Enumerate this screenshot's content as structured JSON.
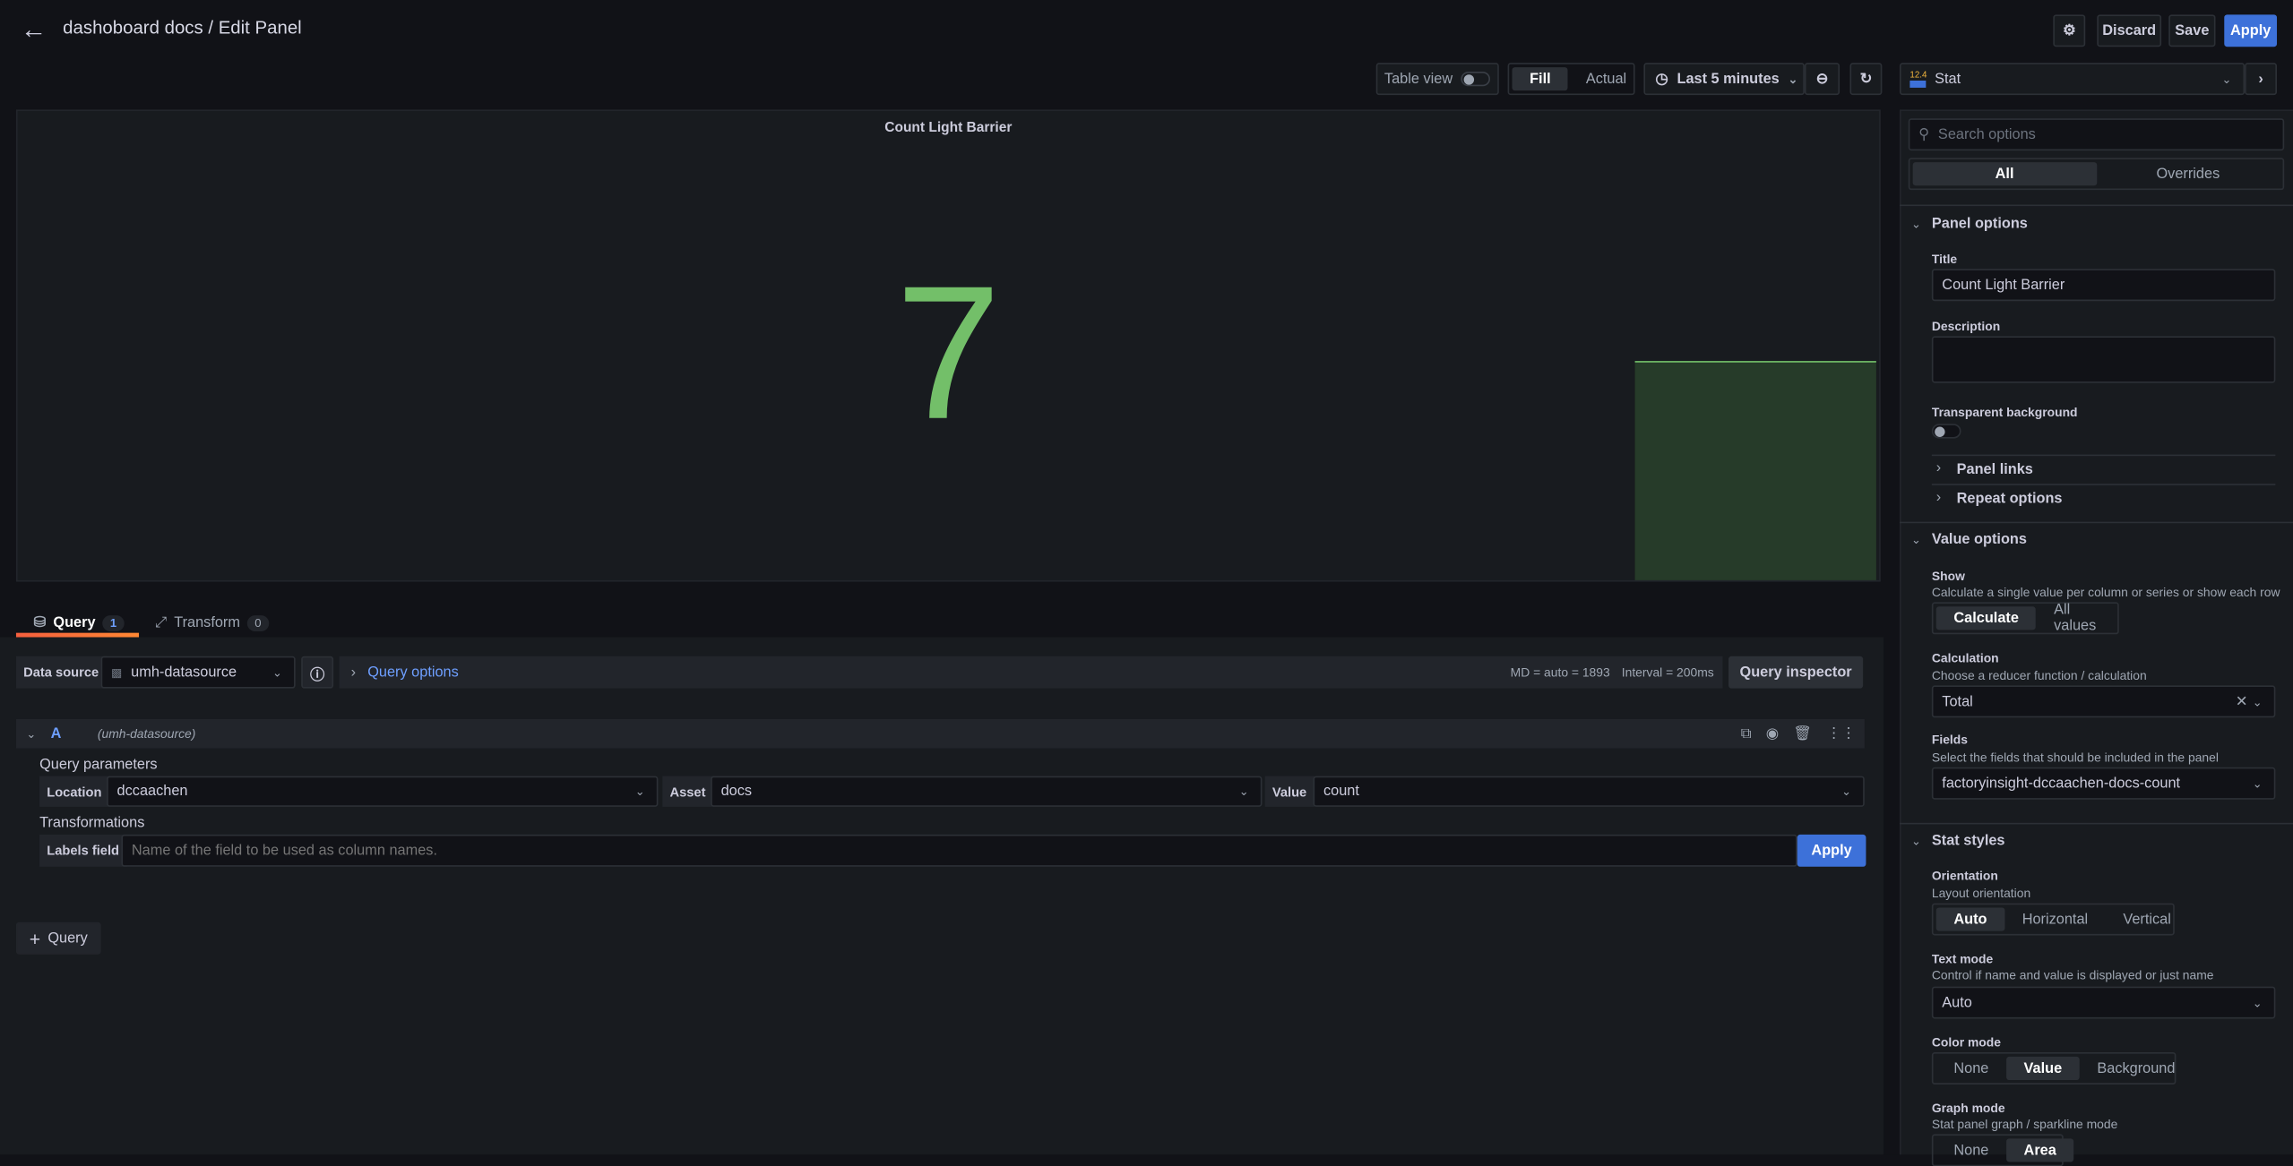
{
  "header": {
    "title": "dashoboard docs / Edit Panel",
    "discard": "Discard",
    "save": "Save",
    "apply": "Apply"
  },
  "toolbar": {
    "table_view": "Table view",
    "fill": "Fill",
    "actual": "Actual",
    "time_range": "Last 5 minutes",
    "visualization": "Stat",
    "viz_icon_text": "12.4"
  },
  "panel": {
    "title": "Count Light Barrier",
    "value": "7",
    "value_color": "#73bf69"
  },
  "tabs": [
    {
      "label": "Query",
      "count": "1"
    },
    {
      "label": "Transform",
      "count": "0"
    }
  ],
  "datasource": {
    "label": "Data source",
    "value": "umh-datasource",
    "query_options": "Query options",
    "md": "MD = auto = 1893",
    "interval": "Interval = 200ms",
    "inspector": "Query inspector"
  },
  "query": {
    "ref": "A",
    "source": "(umh-datasource)",
    "params_label": "Query parameters",
    "location_label": "Location",
    "location": "dccaachen",
    "asset_label": "Asset",
    "asset": "docs",
    "value_label": "Value",
    "value": "count",
    "transformations_label": "Transformations",
    "labels_field_label": "Labels field",
    "labels_field_placeholder": "Name of the field to be used as column names.",
    "apply": "Apply"
  },
  "add_query": "Query",
  "options": {
    "search_placeholder": "Search options",
    "tab_all": "All",
    "tab_overrides": "Overrides",
    "panel_options": "Panel options",
    "title_label": "Title",
    "title_value": "Count Light Barrier",
    "description_label": "Description",
    "transparent_label": "Transparent background",
    "panel_links": "Panel links",
    "repeat_options": "Repeat options",
    "value_options": "Value options",
    "show_label": "Show",
    "show_desc": "Calculate a single value per column or series or show each row",
    "show_opts": [
      "Calculate",
      "All values"
    ],
    "calc_label": "Calculation",
    "calc_desc": "Choose a reducer function / calculation",
    "calc_value": "Total",
    "fields_label": "Fields",
    "fields_desc": "Select the fields that should be included in the panel",
    "fields_value": "factoryinsight-dccaachen-docs-count",
    "stat_styles": "Stat styles",
    "orientation_label": "Orientation",
    "orientation_desc": "Layout orientation",
    "orientation_opts": [
      "Auto",
      "Horizontal",
      "Vertical"
    ],
    "text_mode_label": "Text mode",
    "text_mode_desc": "Control if name and value is displayed or just name",
    "text_mode_value": "Auto",
    "color_mode_label": "Color mode",
    "color_mode_opts": [
      "None",
      "Value",
      "Background"
    ],
    "graph_mode_label": "Graph mode",
    "graph_mode_desc": "Stat panel graph / sparkline mode",
    "graph_mode_opts": [
      "None",
      "Area"
    ]
  }
}
